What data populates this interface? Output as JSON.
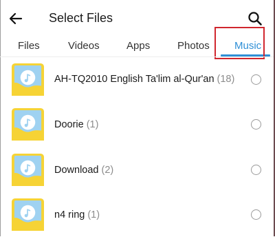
{
  "header": {
    "title": "Select Files",
    "back_icon": "arrow-left-icon",
    "search_icon": "search-icon"
  },
  "tabs": [
    {
      "label": "Files",
      "active": false
    },
    {
      "label": "Videos",
      "active": false
    },
    {
      "label": "Apps",
      "active": false
    },
    {
      "label": "Photos",
      "active": false
    },
    {
      "label": "Music",
      "active": true
    }
  ],
  "colors": {
    "accent": "#2f8fd6",
    "highlight": "#d0262e",
    "folder_yellow": "#f6d335",
    "folder_blue": "#9fd2f1"
  },
  "folders": [
    {
      "name": "AH-TQ2010 English Ta'lim al-Qur'an",
      "count": "(18)",
      "icon": "music-folder-icon"
    },
    {
      "name": "Doorie",
      "count": "(1)",
      "icon": "music-folder-icon"
    },
    {
      "name": "Download",
      "count": "(2)",
      "icon": "music-folder-icon"
    },
    {
      "name": "n4 ring",
      "count": "(1)",
      "icon": "music-folder-icon"
    }
  ]
}
